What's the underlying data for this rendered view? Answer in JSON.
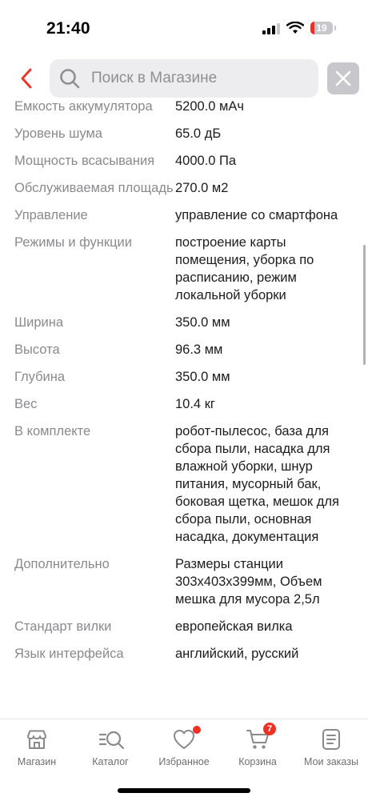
{
  "status_bar": {
    "time": "21:40",
    "battery": "19",
    "battery_level": 0.19
  },
  "search": {
    "placeholder": "Поиск в Магазине"
  },
  "specs": [
    {
      "label": "Емкость аккумулятора",
      "value": "5200.0 мАч"
    },
    {
      "label": "Уровень шума",
      "value": "65.0 дБ"
    },
    {
      "label": "Мощность всасывания",
      "value": "4000.0 Па"
    },
    {
      "label": "Обслуживаемая площадь",
      "value": "270.0 м2"
    },
    {
      "label": "Управление",
      "value": "управление со смартфона"
    },
    {
      "label": "Режимы и функции",
      "value": "построение карты помещения, уборка по расписанию, режим локальной уборки"
    },
    {
      "label": "Ширина",
      "value": "350.0 мм"
    },
    {
      "label": "Высота",
      "value": "96.3 мм"
    },
    {
      "label": "Глубина",
      "value": "350.0 мм"
    },
    {
      "label": "Вес",
      "value": "10.4 кг"
    },
    {
      "label": "В комплекте",
      "value": "робот-пылесос, база для сбора пыли, насадка для влажной уборки, шнур питания, мусорный бак, боковая щетка, мешок для сбора пыли, основная насадка, документация"
    },
    {
      "label": "Дополнительно",
      "value": "Размеры станции 303х403х399мм, Объем мешка для мусора 2,5л"
    },
    {
      "label": "Стандарт вилки",
      "value": "европейская вилка"
    },
    {
      "label": "Язык интерфейса",
      "value": "английский, русский"
    }
  ],
  "tabs": [
    {
      "label": "Магазин",
      "icon": "store-icon"
    },
    {
      "label": "Каталог",
      "icon": "catalog-search-icon"
    },
    {
      "label": "Избранное",
      "icon": "heart-icon",
      "dot": true
    },
    {
      "label": "Корзина",
      "icon": "cart-icon",
      "badge": "7"
    },
    {
      "label": "Мои заказы",
      "icon": "orders-icon"
    }
  ],
  "colors": {
    "accent": "#ef3124",
    "label_text": "#8a8a8e",
    "value_text": "#1c1c1e",
    "search_bg": "#ededf0"
  }
}
